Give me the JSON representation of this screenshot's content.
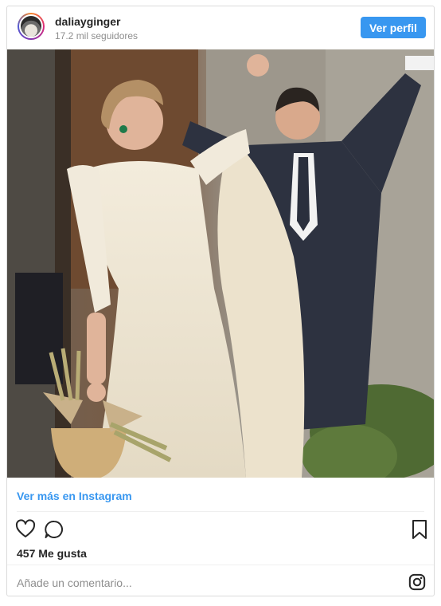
{
  "post": {
    "username": "daliayginger",
    "followers": "17.2 mil seguidores",
    "follow_button": "Ver perfil",
    "view_more": "Ver más en Instagram",
    "likes": "457 Me gusta",
    "comment_placeholder": "Añade un comentario..."
  },
  "icons": {
    "heart": "heart-icon",
    "comment": "comment-icon",
    "bookmark": "bookmark-icon",
    "instagram": "instagram-logo-icon"
  },
  "colors": {
    "accent": "#3897f0",
    "text": "#262626",
    "muted": "#8e8e8e",
    "border": "#dbdbdb"
  }
}
